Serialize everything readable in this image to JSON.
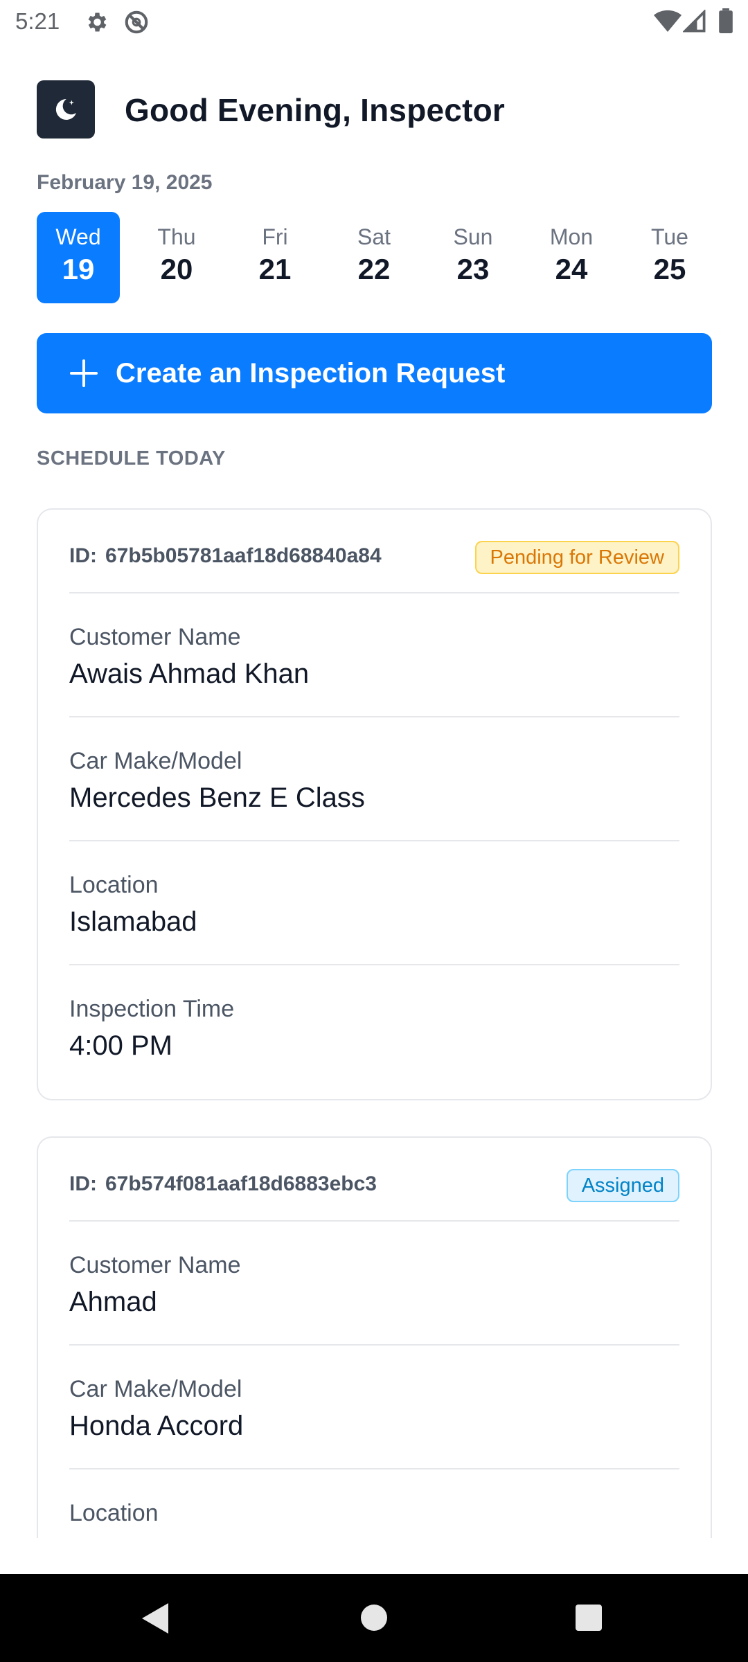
{
  "status_bar": {
    "time": "5:21",
    "icons_left": [
      "gear-icon",
      "do-not-disturb-icon"
    ],
    "icons_right": [
      "wifi-icon",
      "cellular-signal-icon",
      "battery-icon"
    ]
  },
  "header": {
    "greeting": "Good Evening, Inspector",
    "icon": "moon-icon"
  },
  "date_label": "February 19, 2025",
  "week": [
    {
      "name": "Wed",
      "num": "19",
      "selected": true
    },
    {
      "name": "Thu",
      "num": "20",
      "selected": false
    },
    {
      "name": "Fri",
      "num": "21",
      "selected": false
    },
    {
      "name": "Sat",
      "num": "22",
      "selected": false
    },
    {
      "name": "Sun",
      "num": "23",
      "selected": false
    },
    {
      "name": "Mon",
      "num": "24",
      "selected": false
    },
    {
      "name": "Tue",
      "num": "25",
      "selected": false
    }
  ],
  "cta": {
    "label": "Create an Inspection Request",
    "icon": "plus-icon"
  },
  "section_title": "SCHEDULE TODAY",
  "cards": [
    {
      "id_label": "ID:",
      "id": "67b5b05781aaf18d68840a84",
      "status": "Pending for Review",
      "fields": [
        {
          "label": "Customer Name",
          "value": "Awais Ahmad Khan"
        },
        {
          "label": "Car Make/Model",
          "value": "Mercedes Benz E Class"
        },
        {
          "label": "Location",
          "value": "Islamabad"
        },
        {
          "label": "Inspection Time",
          "value": "4:00 PM"
        }
      ]
    },
    {
      "id_label": "ID:",
      "id": "67b574f081aaf18d6883ebc3",
      "status": "Assigned",
      "fields": [
        {
          "label": "Customer Name",
          "value": "Ahmad"
        },
        {
          "label": "Car Make/Model",
          "value": "Honda Accord"
        },
        {
          "label": "Location",
          "value": ""
        }
      ]
    }
  ],
  "colors": {
    "accent": "#0a7cff",
    "pending": "#d97706",
    "assigned": "#0284c7"
  },
  "nav_bar": {
    "icons": [
      "back-icon",
      "home-icon",
      "recents-icon"
    ]
  }
}
